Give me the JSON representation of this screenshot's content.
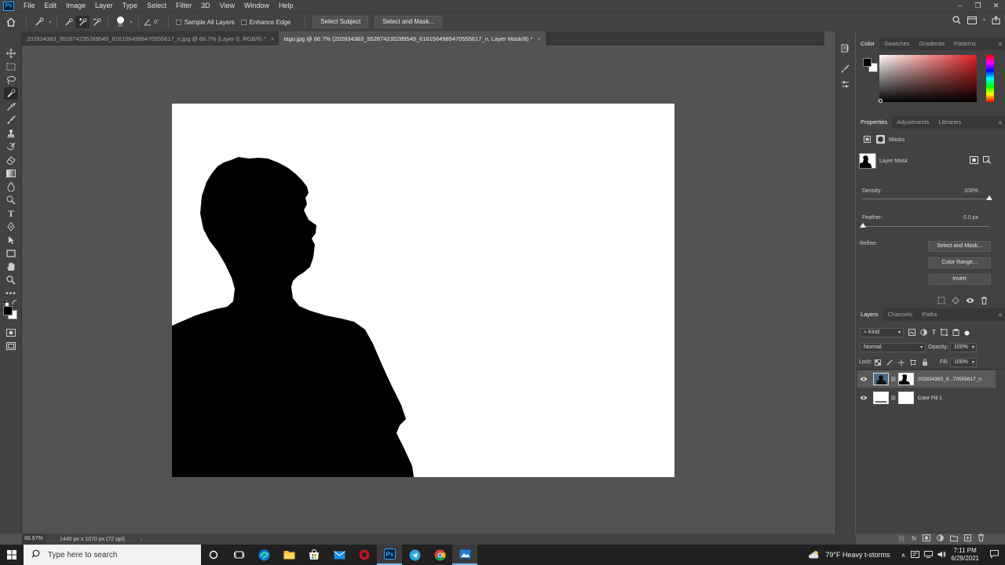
{
  "menu": {
    "logo": "Ps",
    "items": [
      "File",
      "Edit",
      "Image",
      "Layer",
      "Type",
      "Select",
      "Filter",
      "3D",
      "View",
      "Window",
      "Help"
    ]
  },
  "window_controls": {
    "minimize": "–",
    "restore": "❐",
    "close": "✕"
  },
  "options_bar": {
    "brush_size": "30",
    "angle": "0°",
    "sample_all_layers": "Sample All Layers",
    "enhance_edge": "Enhance Edge",
    "select_subject": "Select Subject",
    "select_and_mask": "Select and Mask..."
  },
  "tabs": [
    {
      "label": "202834383_952874235289549_6161564989470555617_n.jpg @ 66.7% (Layer 0, RGB/8) *",
      "close": "×",
      "active": false
    },
    {
      "label": "tago.jpg @ 66.7% (202834383_952874235289549_6161564989470555617_n, Layer Mask/8) *",
      "close": "×",
      "active": true
    }
  ],
  "color_panel": {
    "tabs": [
      "Color",
      "Swatches",
      "Gradients",
      "Patterns"
    ],
    "accent_color": "#e02020"
  },
  "properties_panel": {
    "tabs": [
      "Properties",
      "Adjustments",
      "Libraries"
    ],
    "section": "Masks",
    "mask_name": "Layer Mask",
    "density_label": "Density:",
    "density_value": "100%",
    "density_level": 1.0,
    "feather_label": "Feather:",
    "feather_value": "0.0 px",
    "feather_level": 0.0,
    "refine_label": "Refine:",
    "select_and_mask": "Select and Mask...",
    "color_range": "Color Range...",
    "invert": "Invert"
  },
  "layers_panel": {
    "tabs": [
      "Layers",
      "Channels",
      "Paths"
    ],
    "filter_kind": "Kind",
    "blend_mode": "Normal",
    "opacity_label": "Opacity:",
    "opacity_value": "100%",
    "lock_label": "Lock:",
    "fill_label": "Fill:",
    "fill_value": "100%",
    "layers": [
      {
        "name": "202834383_9...70555617_n",
        "visible": true,
        "selected": true
      },
      {
        "name": "Color Fill 1",
        "visible": true,
        "selected": false
      }
    ]
  },
  "status_bar": {
    "zoom": "66.67%",
    "doc_info": "1440 px x 1070 px (72 ppi)",
    "arrow": "›"
  },
  "taskbar": {
    "search_placeholder": "Type here to search",
    "weather": "79°F  Heavy t-storms",
    "time": "7:11 PM",
    "date": "6/29/2021"
  }
}
